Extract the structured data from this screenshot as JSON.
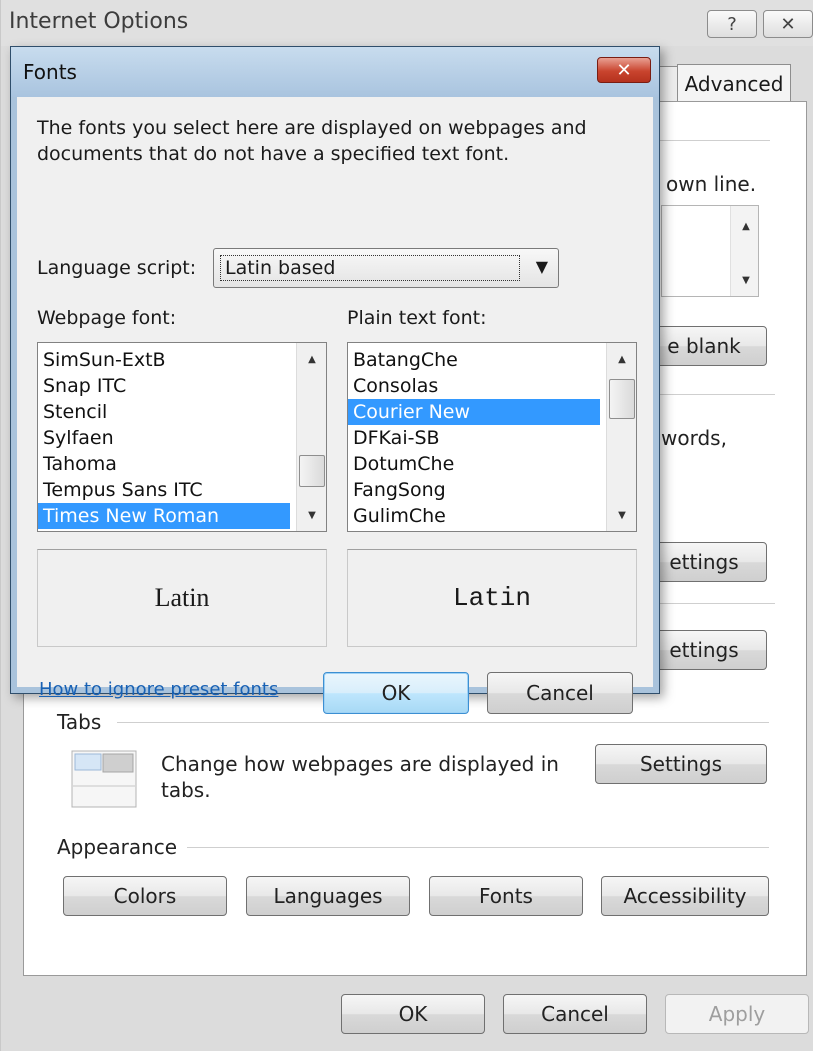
{
  "window": {
    "title": "Internet Options",
    "help_glyph": "?",
    "close_glyph": "✕",
    "tab_advanced": "Advanced"
  },
  "background_panel": {
    "partial_text_1": "own line.",
    "partial_button_1": "e blank",
    "partial_text_2": "words,",
    "partial_button_2": "ettings",
    "partial_button_3": "ettings"
  },
  "tabs_section": {
    "heading": "Tabs",
    "description_line1": "Change how webpages are displayed in",
    "description_line2": "tabs.",
    "settings_label": "Settings"
  },
  "appearance_section": {
    "heading": "Appearance",
    "buttons": [
      "Colors",
      "Languages",
      "Fonts",
      "Accessibility"
    ]
  },
  "footer": {
    "ok": "OK",
    "cancel": "Cancel",
    "apply": "Apply"
  },
  "fonts_dialog": {
    "title": "Fonts",
    "close_glyph": "✕",
    "description_line1": "The fonts you select here are displayed on webpages and",
    "description_line2": "documents that do not have a specified text font.",
    "language_label": "Language script:",
    "language_value": "Latin based",
    "webpage_font_label": "Webpage font:",
    "plain_text_font_label": "Plain text font:",
    "webpage_fonts": [
      "SimSun-ExtB",
      "Snap ITC",
      "Stencil",
      "Sylfaen",
      "Tahoma",
      "Tempus Sans ITC",
      "Times New Roman"
    ],
    "webpage_selected": "Times New Roman",
    "plain_text_fonts": [
      "BatangChe",
      "Consolas",
      "Courier New",
      "DFKai-SB",
      "DotumChe",
      "FangSong",
      "GulimChe"
    ],
    "plain_text_selected": "Courier New",
    "webpage_preview": "Latin",
    "plain_text_preview": "Latin",
    "link": "How to ignore preset fonts",
    "ok": "OK",
    "cancel": "Cancel"
  }
}
